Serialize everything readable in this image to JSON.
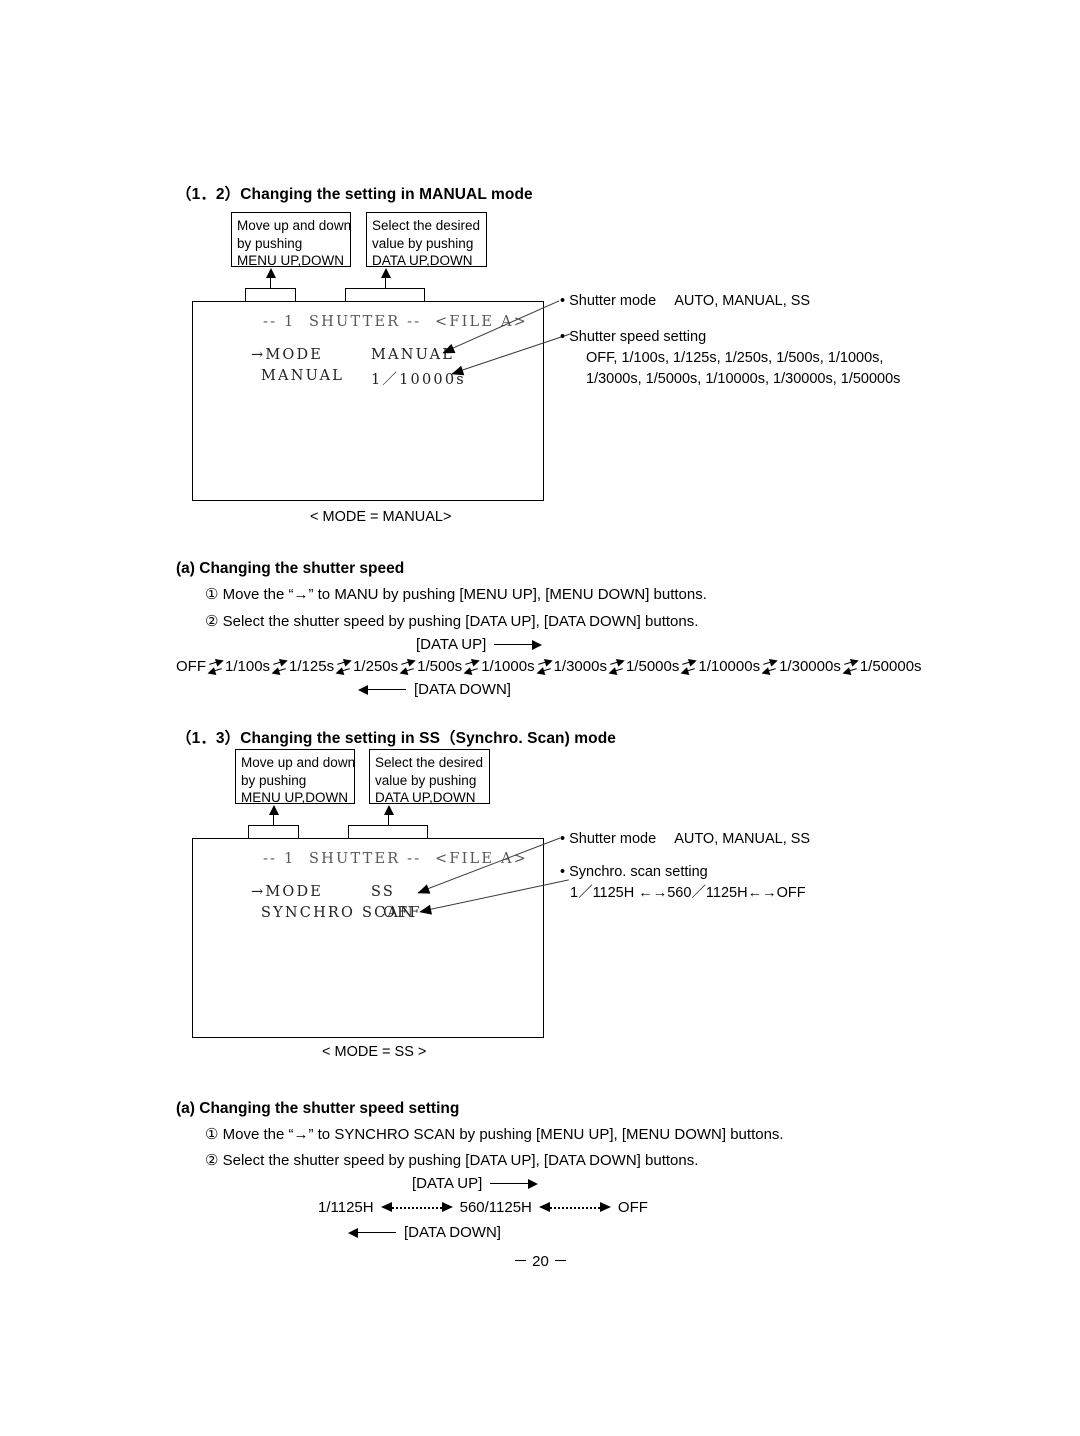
{
  "page": {
    "number": "－ 20 －"
  },
  "section_manual": {
    "heading": "（1．2）Changing the setting in MANUAL mode",
    "callout_left": {
      "line1": "Move up and down",
      "line2": "by pushing",
      "line3": "MENU UP,DOWN"
    },
    "callout_right": {
      "line1": "Select the desired",
      "line2": "value by pushing",
      "line3": "DATA UP,DOWN"
    },
    "monitor": {
      "title": "-- 1  SHUTTER --  <FILE A>",
      "row1_label": "→MODE",
      "row1_value": "MANUAL",
      "row2_label": "MANUAL",
      "row2_value": "1／10000s"
    },
    "mode_caption": "< MODE = MANUAL>",
    "annotations": {
      "shutter_mode_label": "• Shutter mode",
      "shutter_mode_values": "AUTO, MANUAL, SS",
      "shutter_speed_label": "• Shutter speed setting",
      "shutter_speed_line1": "OFF, 1/100s, 1/125s, 1/250s, 1/500s, 1/1000s,",
      "shutter_speed_line2": "1/3000s, 1/5000s, 1/10000s, 1/30000s, 1/50000s"
    },
    "sub_heading": "(a) Changing the shutter speed",
    "steps": [
      "① Move the “→” to MANU by pushing [MENU UP], [MENU DOWN] buttons.",
      "② Select the shutter speed by pushing [DATA UP], [DATA DOWN] buttons."
    ],
    "sequence": {
      "up_label": "[DATA UP]",
      "down_label": "[DATA DOWN]",
      "items": [
        "OFF",
        "1/100s",
        "1/125s",
        "1/250s",
        "1/500s",
        "1/1000s",
        "1/3000s",
        "1/5000s",
        "1/10000s",
        "1/30000s",
        "1/50000s"
      ]
    }
  },
  "section_ss": {
    "heading": "（1．3）Changing the setting in SS（Synchro. Scan) mode",
    "callout_left": {
      "line1": "Move up and down",
      "line2": "by pushing",
      "line3": "MENU UP,DOWN"
    },
    "callout_right": {
      "line1": "Select the desired",
      "line2": "value by pushing",
      "line3": "DATA UP,DOWN"
    },
    "monitor": {
      "title": "-- 1  SHUTTER --  <FILE A>",
      "row1_label": "→MODE",
      "row1_value": "SS",
      "row2_label": "SYNCHRO SCAN",
      "row2_value": "OFF"
    },
    "mode_caption": "< MODE = SS >",
    "annotations": {
      "shutter_mode_label": "• Shutter mode",
      "shutter_mode_values": "AUTO, MANUAL, SS",
      "synchro_label": "• Synchro. scan setting",
      "synchro_range": "1／1125H ←→560／1125H←→OFF"
    },
    "sub_heading": "(a) Changing the shutter speed setting",
    "steps": [
      "① Move the “→” to SYNCHRO SCAN by pushing [MENU UP], [MENU DOWN] buttons.",
      "② Select the shutter speed by pushing [DATA UP], [DATA DOWN] buttons."
    ],
    "sequence": {
      "up_label": "[DATA UP]",
      "down_label": "[DATA DOWN]",
      "items": [
        "1/1125H",
        "560/1125H",
        "OFF"
      ]
    }
  }
}
